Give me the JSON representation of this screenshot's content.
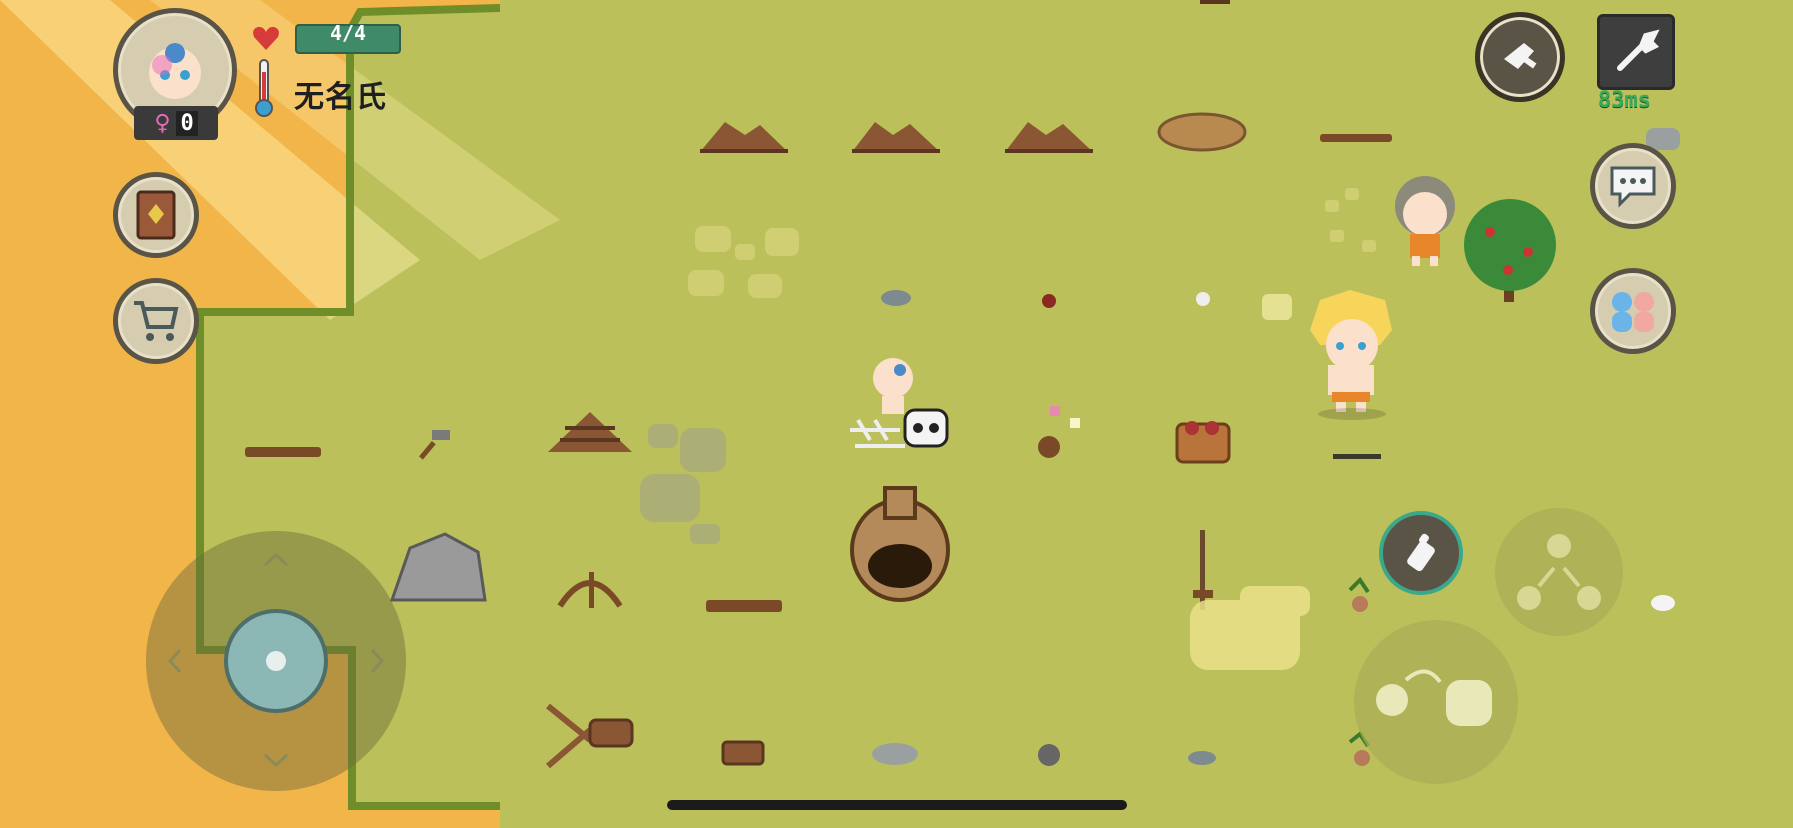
{
  "hud": {
    "health": {
      "label": "4/4",
      "current": 4,
      "max": 4
    },
    "temperature_level": 0.3,
    "player_name": "无名氏",
    "gender_symbol": "♀",
    "gender_count": "0",
    "ping": "83ms",
    "buttons": {
      "avatar": "avatar",
      "journal": "journal-icon",
      "shop": "shopping-cart-icon",
      "quick_item": "meat-icon",
      "settings": "wrench-icon",
      "chat": "chat-bubble-icon",
      "social": "friends-icon",
      "feed": "baby-bottle-icon",
      "split": "split-icon",
      "grab": "grab-hand-icon"
    }
  },
  "colors": {
    "grass": "#bcc05a",
    "sand": "#f2b54a",
    "cliff_edge": "#6f8e2a",
    "health_bar": "#3f8a68",
    "ping_text": "#3aa85a",
    "female": "#e76ab7"
  }
}
